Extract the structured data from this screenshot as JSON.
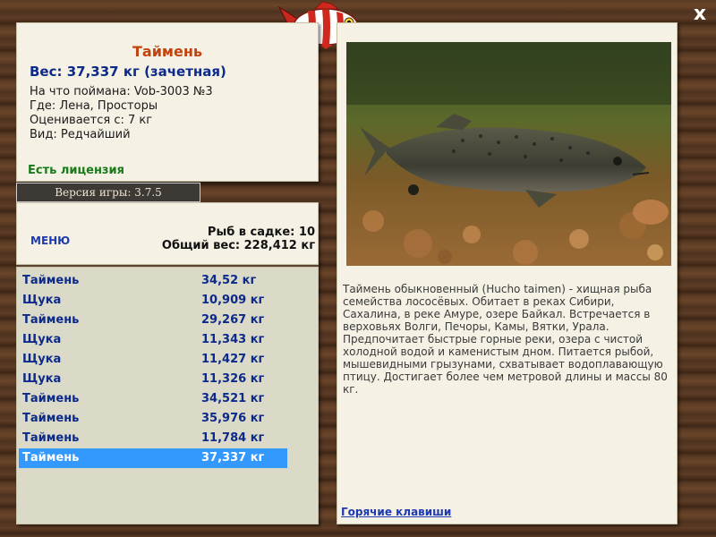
{
  "window": {
    "close_label": "x"
  },
  "fish": {
    "title": "Таймень",
    "weight": "Вес: 37,337 кг (зачетная)",
    "caught_with": "На что поймана: Vob-3003 №3",
    "location": "Где: Лена, Просторы",
    "value": "Оценивается с: 7 кг",
    "species": "Вид: Редчайший",
    "license": "Есть лицензия"
  },
  "version": "Версия игры: 3.7.5",
  "stats": {
    "menu_label": "МЕНЮ",
    "fish_in_keepnet": "Рыб в садке: 10",
    "total_weight": "Общий вес: 228,412 кг"
  },
  "catch_list": [
    {
      "name": "Таймень",
      "weight": "34,52 кг"
    },
    {
      "name": "Щука",
      "weight": "10,909 кг"
    },
    {
      "name": "Таймень",
      "weight": "29,267 кг"
    },
    {
      "name": "Щука",
      "weight": "11,343 кг"
    },
    {
      "name": "Щука",
      "weight": "11,427 кг"
    },
    {
      "name": "Щука",
      "weight": "11,326 кг"
    },
    {
      "name": "Таймень",
      "weight": "34,521 кг"
    },
    {
      "name": "Таймень",
      "weight": "35,976 кг"
    },
    {
      "name": "Таймень",
      "weight": "11,784 кг"
    },
    {
      "name": "Таймень",
      "weight": "37,337 кг",
      "selected": true
    }
  ],
  "description": "Таймень обыкновенный (Hucho taimen) - хищная рыба семейства лососёвых. Обитает в реках Сибири, Сахалина, в реке Амуре, озере Байкал. Встречается в верховьях Волги, Печоры, Камы, Вятки, Урала. Предпочитает быстрые горные реки, озера с чистой холодной водой и каменистым дном. Питается рыбой, мышевидными грызунами, схватывает водоплавающую птицу. Достигает более чем метровой длины и массы 80 кг.",
  "hotkeys_label": "Горячие клавиши",
  "colors": {
    "title": "#c1440e",
    "weight": "#0b2a8a",
    "license": "#1a7a1a",
    "selected_row": "#3399ff",
    "link": "#1e3ab0"
  }
}
